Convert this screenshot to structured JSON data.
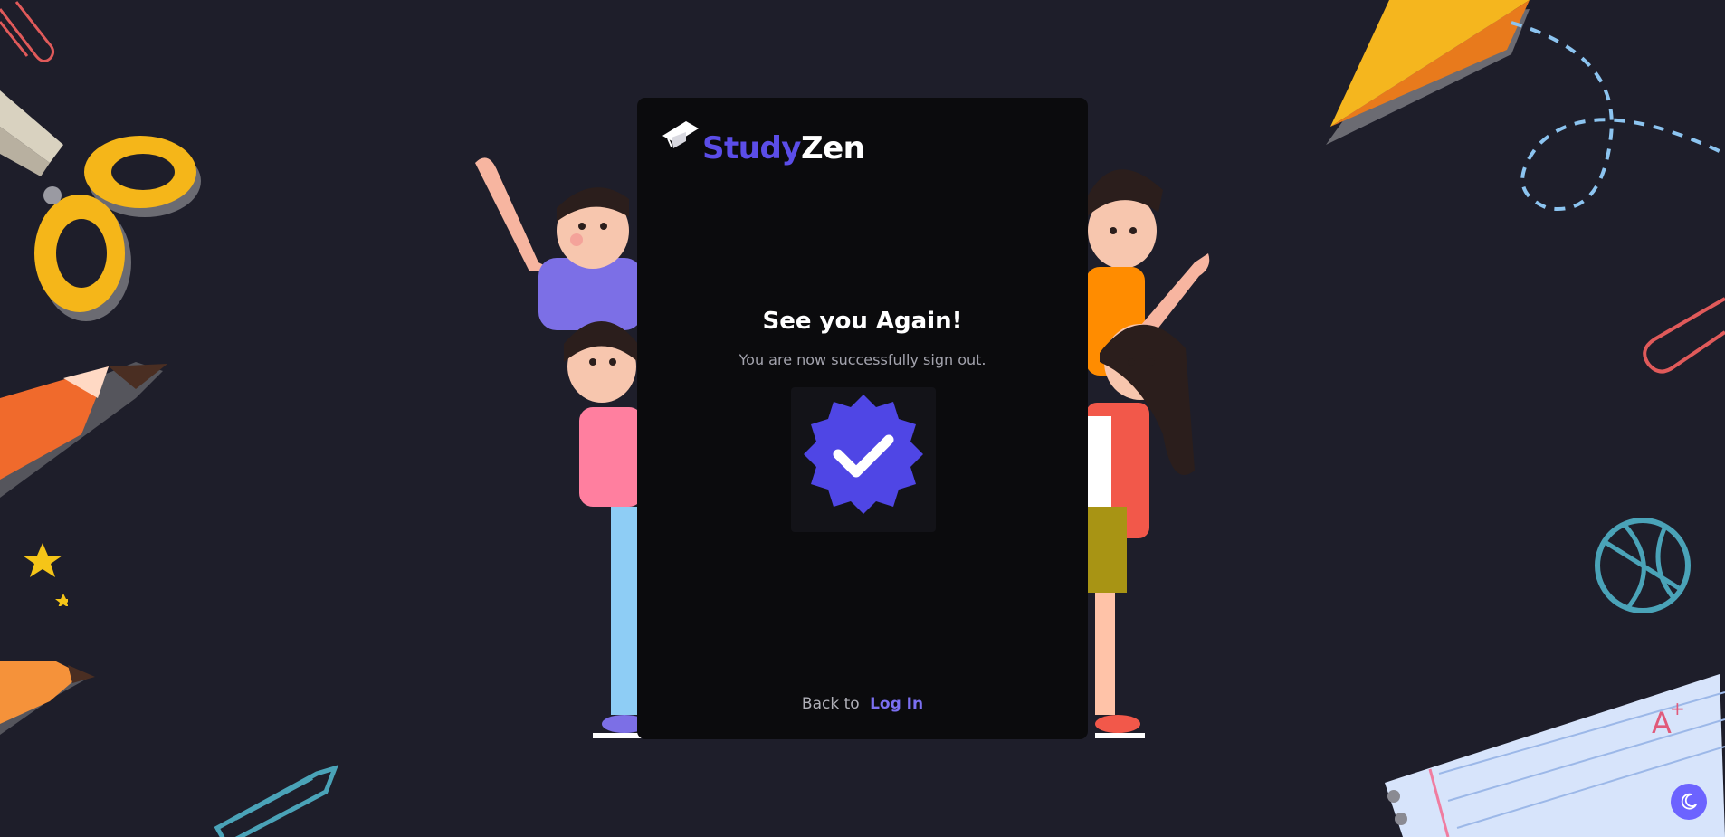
{
  "brand": {
    "name_part1": "Study",
    "name_part2": "Zen",
    "icon": "graduation-cap-icon"
  },
  "card": {
    "title": "See you Again!",
    "subtitle": "You are now successfully sign out.",
    "badge_icon": "verified-check-badge-icon",
    "footer_text": "Back to",
    "footer_link": "Log In"
  },
  "theme_toggle": {
    "icon": "moon-icon"
  },
  "colors": {
    "background": "#1e1e2a",
    "card": "#0b0b0d",
    "accent": "#5b4de8",
    "link": "#7b6ff0",
    "badge": "#4f46e5"
  }
}
